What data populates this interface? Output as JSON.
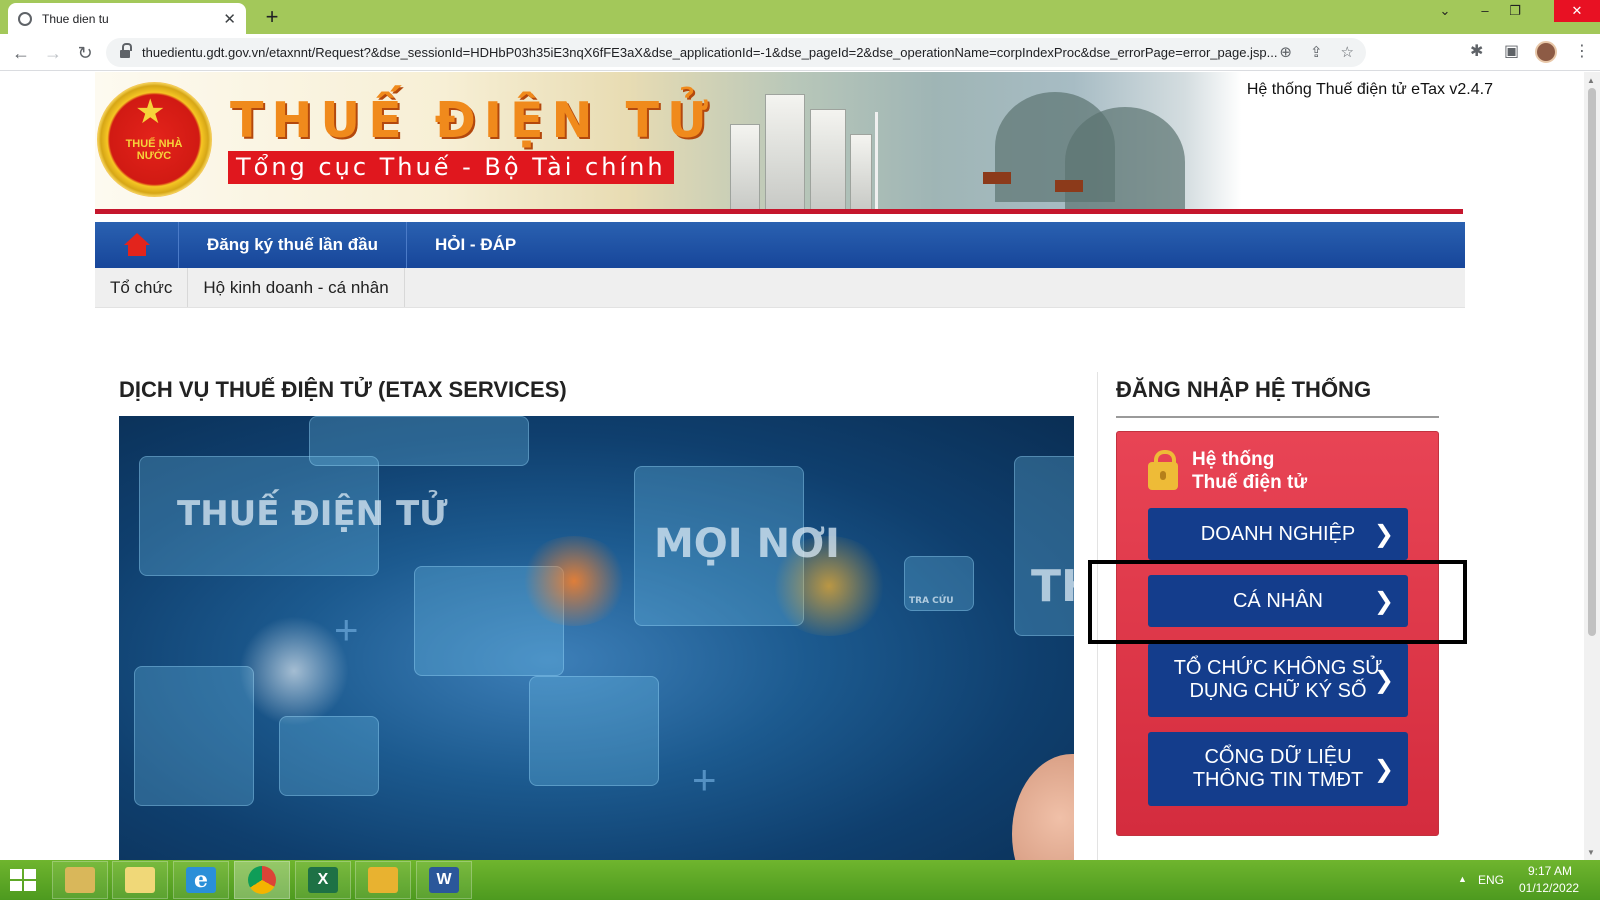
{
  "browser": {
    "tab_title": "Thue dien tu",
    "tab_close": "✕",
    "new_tab": "+",
    "url": "thuedientu.gdt.gov.vn/etaxnnt/Request?&dse_sessionId=HDHbP03h35iE3nqX6fFE3aX&dse_applicationId=-1&dse_pageId=2&dse_operationName=corpIndexProc&dse_errorPage=error_page.jsp...",
    "back": "←",
    "forward": "→",
    "reload": "↻",
    "zoom": "⊕",
    "share": "⇪",
    "bookmark": "☆",
    "extensions": "✱",
    "sidepanel": "▣",
    "menu": "⋮",
    "minimize": "–",
    "restore": "❐",
    "close": "✕",
    "tab_search": "⌄"
  },
  "header": {
    "brand_title": "THUẾ ĐIỆN TỬ",
    "brand_subtitle": "Tổng cục Thuế - Bộ Tài chính",
    "emblem_text": "THUẾ NHÀ NƯỚC",
    "emblem_star": "★",
    "version": "Hệ thống Thuế điện tử eTax v2.4.7"
  },
  "main_nav": {
    "items": [
      "Đăng ký thuế lần đầu",
      "HỎI - ĐÁP"
    ]
  },
  "sub_nav": {
    "items": [
      "Tổ chức",
      "Hộ kinh doanh - cá nhân"
    ]
  },
  "services": {
    "title": "DỊCH VỤ THUẾ ĐIỆN TỬ (ETAX SERVICES)",
    "hero_text_1": "THUẾ ĐIỆN TỬ",
    "hero_text_2": "MỌI NƠI",
    "hero_text_3": "TRA CỨU",
    "hero_text_4": "TH"
  },
  "login": {
    "title": "ĐĂNG NHẬP HỆ THỐNG",
    "system_line1": "Hệ thống",
    "system_line2": "Thuế điện tử",
    "chevron": "❯",
    "buttons": [
      "DOANH NGHIỆP",
      "CÁ NHÂN",
      "TỔ CHỨC KHÔNG SỬ DỤNG CHỮ KÝ SỐ",
      "CỔNG DỮ LIỆU THÔNG TIN TMĐT"
    ]
  },
  "taskbar": {
    "apps": [
      "file-explorer",
      "folder",
      "internet-explorer",
      "chrome",
      "excel",
      "folder-arrow",
      "word"
    ],
    "excel_glyph": "X",
    "word_glyph": "W",
    "ie_glyph": "e",
    "lang": "ENG",
    "time": "9:17 AM",
    "date": "01/12/2022",
    "tray_arrow": "▲"
  },
  "colors": {
    "tabbar": "#a3c85a",
    "nav_blue": "#17469a",
    "login_red": "#d42c3e",
    "button_blue": "#143d8c",
    "taskbar": "#4d9a1f"
  }
}
